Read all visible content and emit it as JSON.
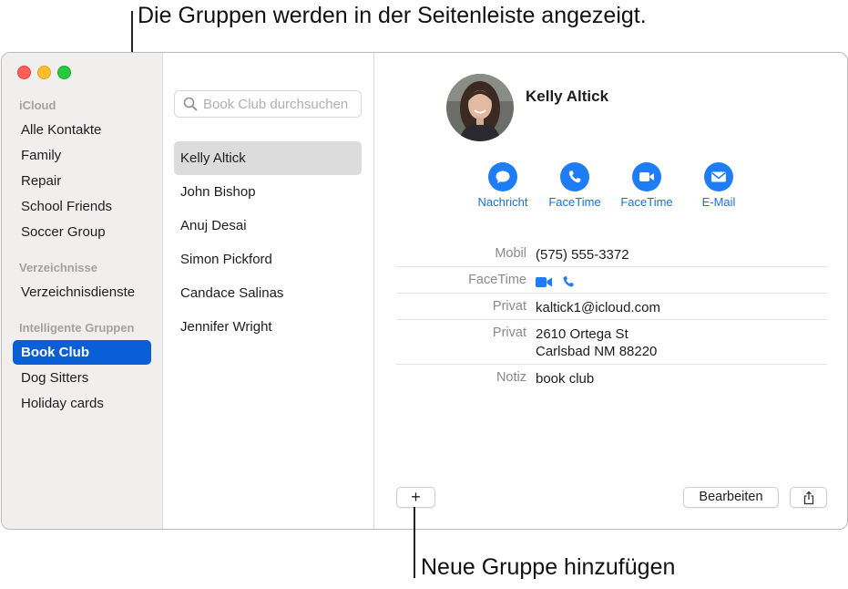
{
  "callouts": {
    "top": "Die Gruppen werden in der Seitenleiste angezeigt.",
    "bottom": "Neue Gruppe hinzufügen"
  },
  "sidebar": {
    "sections": [
      {
        "header": "iCloud",
        "items": [
          "Alle Kontakte",
          "Family",
          "Repair",
          "School Friends",
          "Soccer Group"
        ]
      },
      {
        "header": "Verzeichnisse",
        "items": [
          "Verzeichnisdienste"
        ]
      },
      {
        "header": "Intelligente Gruppen",
        "items": [
          "Book Club",
          "Dog Sitters",
          "Holiday cards"
        ]
      }
    ],
    "selected": "Book Club"
  },
  "list": {
    "search_placeholder": "Book Club durchsuchen",
    "contacts": [
      "Kelly Altick",
      "John Bishop",
      "Anuj Desai",
      "Simon Pickford",
      "Candace Salinas",
      "Jennifer Wright"
    ],
    "selected": "Kelly Altick"
  },
  "detail": {
    "name": "Kelly Altick",
    "actions": [
      {
        "label": "Nachricht",
        "icon": "message-icon"
      },
      {
        "label": "FaceTime",
        "icon": "phone-icon"
      },
      {
        "label": "FaceTime",
        "icon": "video-icon"
      },
      {
        "label": "E-Mail",
        "icon": "mail-icon"
      }
    ],
    "fields": [
      {
        "label": "Mobil",
        "value": "(575) 555-3372"
      },
      {
        "label": "FaceTime",
        "value": ""
      },
      {
        "label": "Privat",
        "value": "kaltick1@icloud.com"
      },
      {
        "label": "Privat",
        "value": "2610 Ortega St",
        "value2": "Carlsbad NM 88220"
      },
      {
        "label": "Notiz",
        "value": "book club"
      }
    ],
    "add_button": "+",
    "edit_button": "Bearbeiten"
  },
  "colors": {
    "accent": "#0a5fd6",
    "action_blue": "#1e7cf5",
    "sidebar_bg": "#f0efee"
  }
}
